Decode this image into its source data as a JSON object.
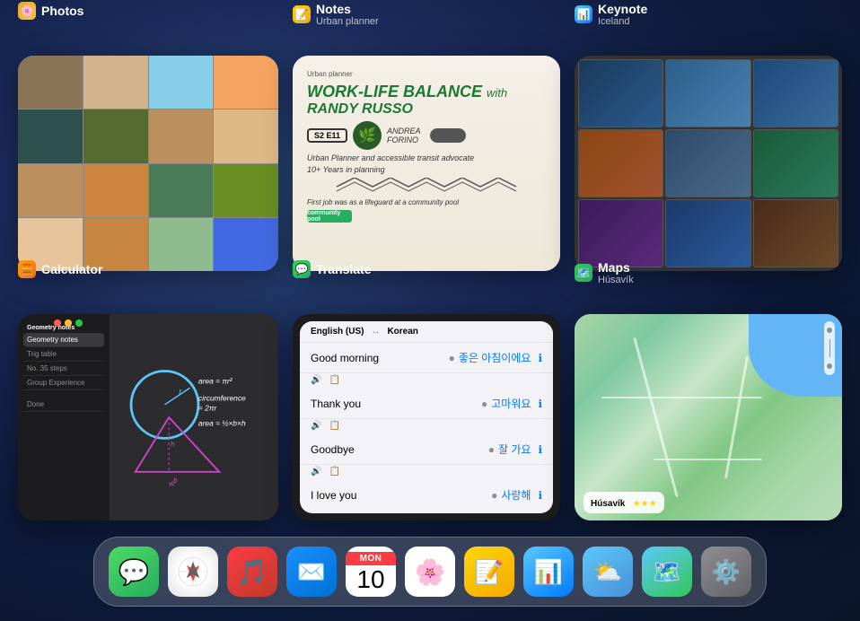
{
  "background": {
    "color1": "#2a4a7a",
    "color2": "#0d1a3a"
  },
  "app_cards": [
    {
      "id": "photos",
      "title": "Photos",
      "subtitle": "",
      "icon": "🖼️",
      "icon_color": "#e8a828"
    },
    {
      "id": "calculator",
      "title": "Calculator",
      "subtitle": "",
      "icon": "🧮",
      "icon_color": "#ff9f0a"
    },
    {
      "id": "notes",
      "title": "Notes",
      "subtitle": "Urban planner",
      "icon": "📝",
      "icon_color": "#ffd60a"
    },
    {
      "id": "translate",
      "title": "Translate",
      "subtitle": "",
      "icon": "💬",
      "icon_color": "#30d158"
    },
    {
      "id": "keynote",
      "title": "Keynote",
      "subtitle": "Iceland",
      "icon": "📊",
      "icon_color": "#5ac8fa"
    },
    {
      "id": "maps",
      "title": "Maps",
      "subtitle": "Húsavík",
      "icon": "🗺️",
      "icon_color": "#34c759"
    }
  ],
  "notes_content": {
    "main_title": "WORK-LIFE BALANCE",
    "with_text": "with",
    "name": "RANDY RUSSO",
    "badge": "S2 E11",
    "subtitle": "Urban Planner and accessible transit advocate",
    "years": "10+ Years in planning",
    "early": "First job was as a lifeguard at a community pool"
  },
  "translate_rows": [
    {
      "english": "Good morning",
      "korean": "좋은 아침이에요",
      "label": "English (US)"
    },
    {
      "english": "Thank you",
      "korean": "고마워요",
      "label": "English (US)"
    },
    {
      "english": "Goodbye",
      "korean": "잘 가요",
      "label": "English (US)"
    },
    {
      "english": "I love you",
      "korean": "사랑해",
      "label": "English (US)"
    }
  ],
  "maps_location": "Húsavík",
  "calc_notes_title": "Geometry notes",
  "calc_formulas": [
    "area = πr²",
    "circumference = 2πr",
    "area = ½×b×h"
  ],
  "dock": {
    "items": [
      {
        "id": "messages",
        "label": "Messages",
        "icon_char": "💬",
        "bg": "#4cd964"
      },
      {
        "id": "safari",
        "label": "Safari",
        "icon_char": "🧭",
        "bg": "#ffffff"
      },
      {
        "id": "music",
        "label": "Music",
        "icon_char": "🎵",
        "bg": "#fc3c44"
      },
      {
        "id": "mail",
        "label": "Mail",
        "icon_char": "✉️",
        "bg": "#1a8fff"
      },
      {
        "id": "calendar",
        "label": "Calendar",
        "icon_char": "10",
        "bg": "#ffffff",
        "special": "calendar",
        "day": "MON",
        "num": "10"
      },
      {
        "id": "photos",
        "label": "Photos",
        "icon_char": "🌸",
        "bg": "#ffffff"
      },
      {
        "id": "notes",
        "label": "Notes",
        "icon_char": "📝",
        "bg": "#ffd60a"
      },
      {
        "id": "keynote",
        "label": "Keynote",
        "icon_char": "📊",
        "bg": "#5ac8fa"
      },
      {
        "id": "weather",
        "label": "Weather",
        "icon_char": "⛅",
        "bg": "#5ac8fa"
      },
      {
        "id": "maps",
        "label": "Maps",
        "icon_char": "🗺️",
        "bg": "#34c759"
      },
      {
        "id": "settings",
        "label": "Settings",
        "icon_char": "⚙️",
        "bg": "#8e8e93"
      }
    ],
    "calendar_day": "MON",
    "calendar_num": "10"
  }
}
